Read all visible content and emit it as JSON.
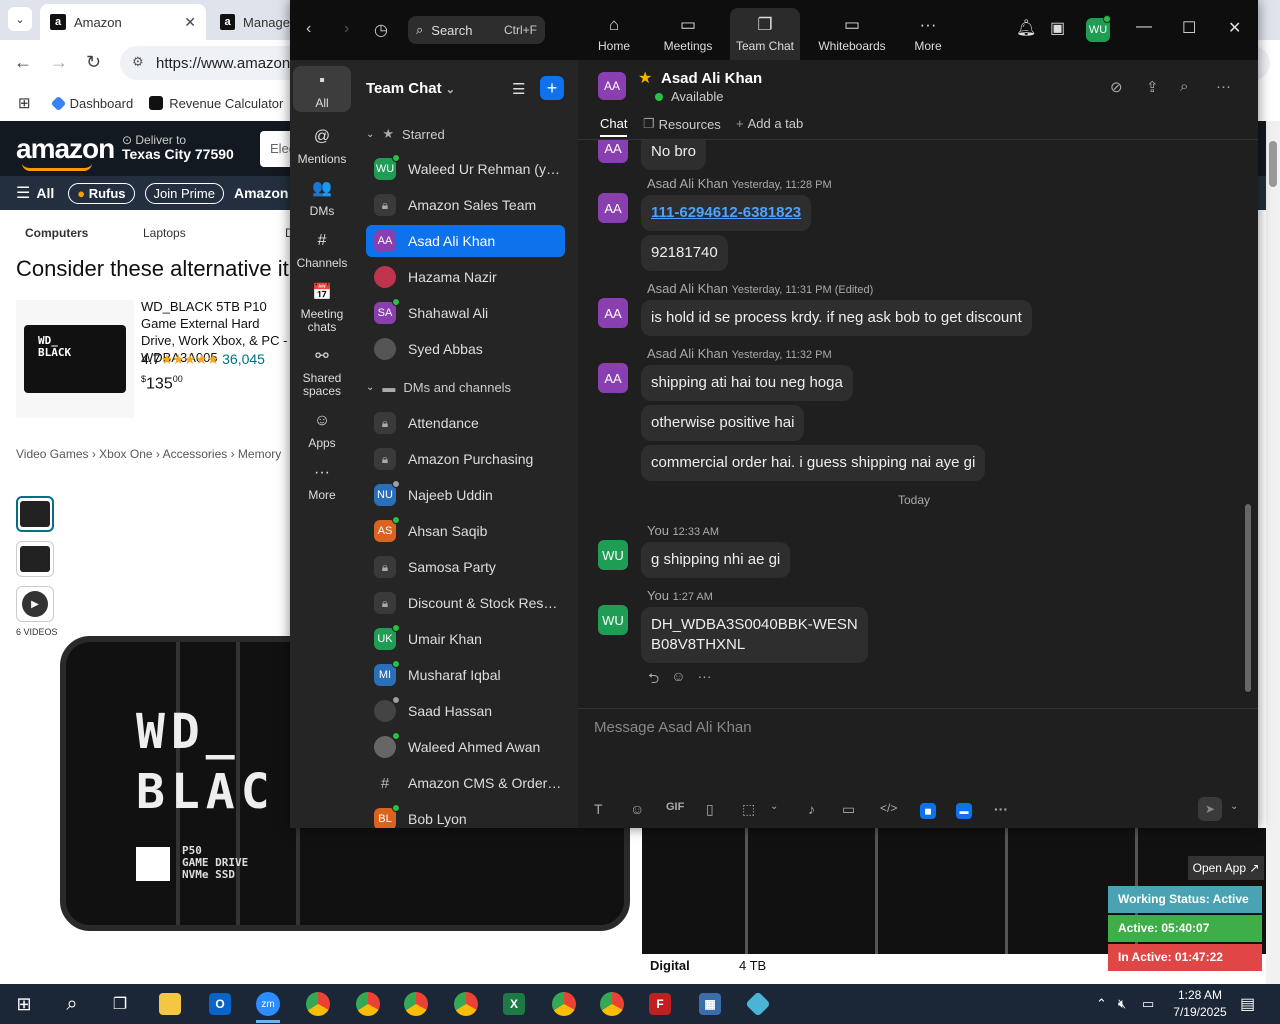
{
  "browser": {
    "tabs": [
      {
        "label": "Amazon",
        "active": true
      },
      {
        "label": "Manage",
        "active": false
      }
    ],
    "url": "https://www.amazon.",
    "bookmarks": [
      "Dashboard",
      "Revenue Calculator"
    ],
    "amazon": {
      "logo": "amazon",
      "deliver_to": "Deliver to",
      "city": "Texas City 77590",
      "search_placeholder": "Elec",
      "nav_all": "All",
      "nav_pills": [
        "Rufus",
        "Join Prime"
      ],
      "nav_more": "Amazon H",
      "categories": [
        "Computers",
        "Laptops",
        "D"
      ],
      "consider_heading": "Consider these alternative it",
      "product": {
        "title": "WD_BLACK 5TB P10 Game External Hard Drive, Work Xbox, & PC - WDBA3A005",
        "rating": "4.7",
        "stars": "★★★★★",
        "review_count": "36,045",
        "price_symbol": "$",
        "price_whole": "135",
        "price_cents": "00",
        "image_text": "WD_\nBLACK"
      },
      "breadcrumb": [
        "Video Games",
        "Xbox One",
        "Accessories",
        "Memory"
      ],
      "videos_label": "6 VIDEOS",
      "big_image": {
        "line1": "WD_",
        "line2": "BLAC",
        "model": "P50\nGAME DRIVE\nNVMe SSD"
      },
      "spec_label": "Digital",
      "spec_value": "4 TB",
      "open_app": "Open App ↗"
    },
    "work_status": [
      {
        "text": "Working Status: Active",
        "color": "#4aa3b3"
      },
      {
        "text": "Active: 05:40:07",
        "color": "#3fae49"
      },
      {
        "text": "In Active: 01:47:22",
        "color": "#e04646"
      }
    ]
  },
  "zoom": {
    "search": {
      "label": "Search",
      "shortcut": "Ctrl+F"
    },
    "nav": [
      {
        "label": "Home",
        "icon": "home-icon",
        "glyph": "⌂",
        "active": false
      },
      {
        "label": "Meetings",
        "icon": "video-icon",
        "glyph": "▭",
        "active": false
      },
      {
        "label": "Team Chat",
        "icon": "chat-icon",
        "glyph": "❐",
        "active": true
      },
      {
        "label": "Whiteboards",
        "icon": "whiteboard-icon",
        "glyph": "▭",
        "active": false
      },
      {
        "label": "More",
        "icon": "more-icon",
        "glyph": "···",
        "active": false
      }
    ],
    "user_initials": "WU",
    "rail": [
      {
        "label": "All",
        "glyph": "▪",
        "active": true
      },
      {
        "label": "Mentions",
        "glyph": "@",
        "active": false
      },
      {
        "label": "DMs",
        "glyph": "👥",
        "active": false
      },
      {
        "label": "Channels",
        "glyph": "#",
        "active": false
      },
      {
        "label": "Meeting chats",
        "glyph": "📅",
        "active": false
      },
      {
        "label": "Shared spaces",
        "glyph": "⚯",
        "active": false
      },
      {
        "label": "Apps",
        "glyph": "☺",
        "active": false
      },
      {
        "label": "More",
        "glyph": "···",
        "active": false
      }
    ],
    "chat_list": {
      "title": "Team Chat",
      "starred_label": "Starred",
      "dms_label": "DMs and channels",
      "starred": [
        {
          "name": "Waleed Ur Rehman (you)",
          "initials": "WU",
          "color": "#1f9d55",
          "kind": "avatar",
          "status": "online"
        },
        {
          "name": "Amazon Sales Team",
          "initials": "",
          "color": "",
          "kind": "lock",
          "status": ""
        },
        {
          "name": "Asad Ali Khan",
          "initials": "AA",
          "color": "#8a3fb0",
          "kind": "avatar",
          "status": "",
          "active": true
        },
        {
          "name": "Hazama Nazir",
          "initials": "",
          "color": "#c0334d",
          "kind": "photo",
          "status": ""
        },
        {
          "name": "Shahawal Ali",
          "initials": "SA",
          "color": "#8a3fb0",
          "kind": "avatar",
          "status": "online"
        },
        {
          "name": "Syed Abbas",
          "initials": "",
          "color": "#555",
          "kind": "photo",
          "status": ""
        }
      ],
      "dms": [
        {
          "name": "Attendance",
          "initials": "",
          "color": "",
          "kind": "lock",
          "status": ""
        },
        {
          "name": "Amazon Purchasing",
          "initials": "",
          "color": "",
          "kind": "lock",
          "status": ""
        },
        {
          "name": "Najeeb Uddin",
          "initials": "NU",
          "color": "#2a6fb8",
          "kind": "avatar",
          "status": "away"
        },
        {
          "name": "Ahsan Saqib",
          "initials": "AS",
          "color": "#d9631f",
          "kind": "avatar",
          "status": "online"
        },
        {
          "name": "Samosa Party",
          "initials": "",
          "color": "",
          "kind": "lock",
          "status": ""
        },
        {
          "name": "Discount & Stock Reser...",
          "initials": "",
          "color": "",
          "kind": "lock",
          "status": ""
        },
        {
          "name": "Umair Khan",
          "initials": "UK",
          "color": "#1f9d55",
          "kind": "avatar",
          "status": "online"
        },
        {
          "name": "Musharaf Iqbal",
          "initials": "MI",
          "color": "#2a6fb8",
          "kind": "avatar",
          "status": "online"
        },
        {
          "name": "Saad Hassan",
          "initials": "",
          "color": "#444",
          "kind": "photo",
          "status": "away"
        },
        {
          "name": "Waleed Ahmed Awan",
          "initials": "",
          "color": "#666",
          "kind": "photo",
          "status": "online"
        },
        {
          "name": "Amazon CMS & OrderA...",
          "initials": "",
          "color": "",
          "kind": "hash",
          "status": ""
        },
        {
          "name": "Bob Lyon",
          "initials": "BL",
          "color": "#d9631f",
          "kind": "avatar",
          "status": "online"
        }
      ]
    },
    "chat": {
      "contact_name": "Asad Ali Khan",
      "contact_initials": "AA",
      "status": "Available",
      "tabs": [
        "Chat",
        "Resources",
        "Add a tab"
      ],
      "today_label": "Today",
      "composer_placeholder": "Message Asad Ali Khan",
      "messages": [
        {
          "who": "aa",
          "initials": "AA",
          "sender": "",
          "time": "",
          "bubbles": [
            "No bro"
          ]
        },
        {
          "who": "aa",
          "initials": "AA",
          "sender": "Asad Ali Khan",
          "time": "Yesterday, 11:28 PM",
          "bubbles": [
            "111-6294612-6381823",
            "92181740"
          ]
        },
        {
          "who": "aa",
          "initials": "AA",
          "sender": "Asad Ali Khan",
          "time": "Yesterday, 11:31 PM (Edited)",
          "bubbles": [
            "is hold id se process krdy. if neg ask bob to get discount"
          ]
        },
        {
          "who": "aa",
          "initials": "AA",
          "sender": "Asad Ali Khan",
          "time": "Yesterday, 11:32 PM",
          "bubbles": [
            "shipping ati hai tou neg hoga",
            "otherwise positive hai",
            "commercial order hai. i guess shipping nai aye gi"
          ]
        },
        {
          "who": "wu",
          "initials": "WU",
          "sender": "You",
          "time": "12:33 AM",
          "bubbles": [
            "g shipping nhi ae gi"
          ]
        },
        {
          "who": "wu",
          "initials": "WU",
          "sender": "You",
          "time": "1:27 AM",
          "bubbles": [
            "DH_WDBA3S0040BBK-WESN\nB08V8THXNL"
          ]
        }
      ]
    }
  },
  "taskbar": {
    "time": "1:28 AM",
    "date": "7/19/2025"
  }
}
